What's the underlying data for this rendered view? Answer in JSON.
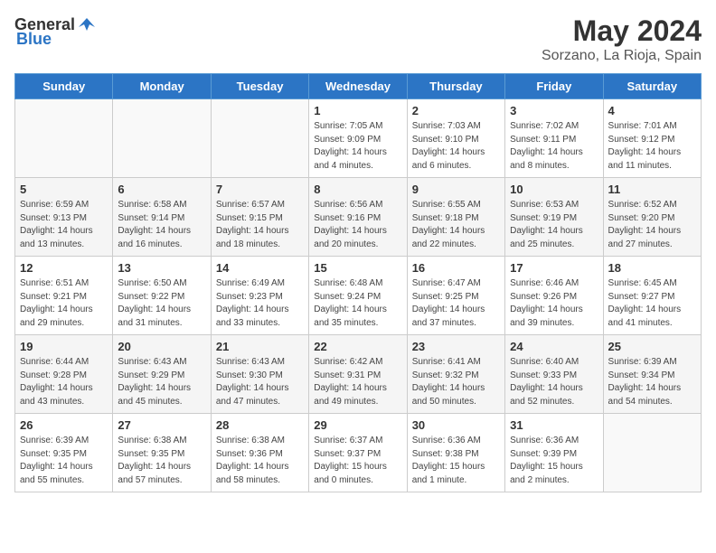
{
  "header": {
    "logo_general": "General",
    "logo_blue": "Blue",
    "title": "May 2024",
    "subtitle": "Sorzano, La Rioja, Spain"
  },
  "weekdays": [
    "Sunday",
    "Monday",
    "Tuesday",
    "Wednesday",
    "Thursday",
    "Friday",
    "Saturday"
  ],
  "weeks": [
    [
      {
        "day": "",
        "info": ""
      },
      {
        "day": "",
        "info": ""
      },
      {
        "day": "",
        "info": ""
      },
      {
        "day": "1",
        "info": "Sunrise: 7:05 AM\nSunset: 9:09 PM\nDaylight: 14 hours\nand 4 minutes."
      },
      {
        "day": "2",
        "info": "Sunrise: 7:03 AM\nSunset: 9:10 PM\nDaylight: 14 hours\nand 6 minutes."
      },
      {
        "day": "3",
        "info": "Sunrise: 7:02 AM\nSunset: 9:11 PM\nDaylight: 14 hours\nand 8 minutes."
      },
      {
        "day": "4",
        "info": "Sunrise: 7:01 AM\nSunset: 9:12 PM\nDaylight: 14 hours\nand 11 minutes."
      }
    ],
    [
      {
        "day": "5",
        "info": "Sunrise: 6:59 AM\nSunset: 9:13 PM\nDaylight: 14 hours\nand 13 minutes."
      },
      {
        "day": "6",
        "info": "Sunrise: 6:58 AM\nSunset: 9:14 PM\nDaylight: 14 hours\nand 16 minutes."
      },
      {
        "day": "7",
        "info": "Sunrise: 6:57 AM\nSunset: 9:15 PM\nDaylight: 14 hours\nand 18 minutes."
      },
      {
        "day": "8",
        "info": "Sunrise: 6:56 AM\nSunset: 9:16 PM\nDaylight: 14 hours\nand 20 minutes."
      },
      {
        "day": "9",
        "info": "Sunrise: 6:55 AM\nSunset: 9:18 PM\nDaylight: 14 hours\nand 22 minutes."
      },
      {
        "day": "10",
        "info": "Sunrise: 6:53 AM\nSunset: 9:19 PM\nDaylight: 14 hours\nand 25 minutes."
      },
      {
        "day": "11",
        "info": "Sunrise: 6:52 AM\nSunset: 9:20 PM\nDaylight: 14 hours\nand 27 minutes."
      }
    ],
    [
      {
        "day": "12",
        "info": "Sunrise: 6:51 AM\nSunset: 9:21 PM\nDaylight: 14 hours\nand 29 minutes."
      },
      {
        "day": "13",
        "info": "Sunrise: 6:50 AM\nSunset: 9:22 PM\nDaylight: 14 hours\nand 31 minutes."
      },
      {
        "day": "14",
        "info": "Sunrise: 6:49 AM\nSunset: 9:23 PM\nDaylight: 14 hours\nand 33 minutes."
      },
      {
        "day": "15",
        "info": "Sunrise: 6:48 AM\nSunset: 9:24 PM\nDaylight: 14 hours\nand 35 minutes."
      },
      {
        "day": "16",
        "info": "Sunrise: 6:47 AM\nSunset: 9:25 PM\nDaylight: 14 hours\nand 37 minutes."
      },
      {
        "day": "17",
        "info": "Sunrise: 6:46 AM\nSunset: 9:26 PM\nDaylight: 14 hours\nand 39 minutes."
      },
      {
        "day": "18",
        "info": "Sunrise: 6:45 AM\nSunset: 9:27 PM\nDaylight: 14 hours\nand 41 minutes."
      }
    ],
    [
      {
        "day": "19",
        "info": "Sunrise: 6:44 AM\nSunset: 9:28 PM\nDaylight: 14 hours\nand 43 minutes."
      },
      {
        "day": "20",
        "info": "Sunrise: 6:43 AM\nSunset: 9:29 PM\nDaylight: 14 hours\nand 45 minutes."
      },
      {
        "day": "21",
        "info": "Sunrise: 6:43 AM\nSunset: 9:30 PM\nDaylight: 14 hours\nand 47 minutes."
      },
      {
        "day": "22",
        "info": "Sunrise: 6:42 AM\nSunset: 9:31 PM\nDaylight: 14 hours\nand 49 minutes."
      },
      {
        "day": "23",
        "info": "Sunrise: 6:41 AM\nSunset: 9:32 PM\nDaylight: 14 hours\nand 50 minutes."
      },
      {
        "day": "24",
        "info": "Sunrise: 6:40 AM\nSunset: 9:33 PM\nDaylight: 14 hours\nand 52 minutes."
      },
      {
        "day": "25",
        "info": "Sunrise: 6:39 AM\nSunset: 9:34 PM\nDaylight: 14 hours\nand 54 minutes."
      }
    ],
    [
      {
        "day": "26",
        "info": "Sunrise: 6:39 AM\nSunset: 9:35 PM\nDaylight: 14 hours\nand 55 minutes."
      },
      {
        "day": "27",
        "info": "Sunrise: 6:38 AM\nSunset: 9:35 PM\nDaylight: 14 hours\nand 57 minutes."
      },
      {
        "day": "28",
        "info": "Sunrise: 6:38 AM\nSunset: 9:36 PM\nDaylight: 14 hours\nand 58 minutes."
      },
      {
        "day": "29",
        "info": "Sunrise: 6:37 AM\nSunset: 9:37 PM\nDaylight: 15 hours\nand 0 minutes."
      },
      {
        "day": "30",
        "info": "Sunrise: 6:36 AM\nSunset: 9:38 PM\nDaylight: 15 hours\nand 1 minute."
      },
      {
        "day": "31",
        "info": "Sunrise: 6:36 AM\nSunset: 9:39 PM\nDaylight: 15 hours\nand 2 minutes."
      },
      {
        "day": "",
        "info": ""
      }
    ]
  ]
}
